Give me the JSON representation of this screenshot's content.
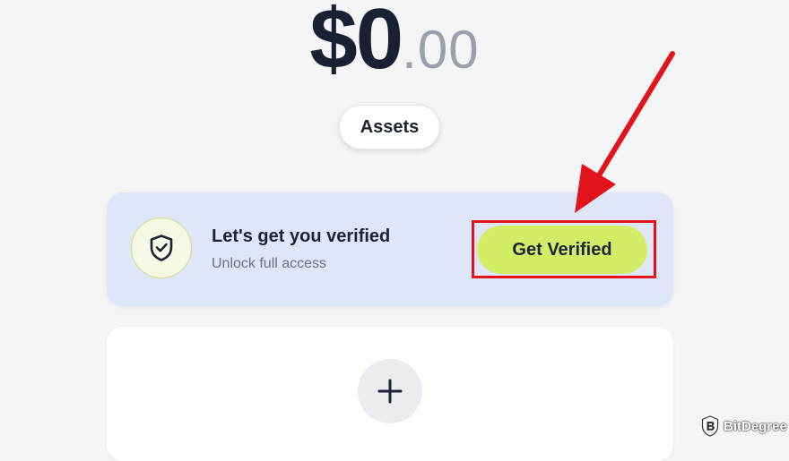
{
  "balance": {
    "main": "$0",
    "cents": ".00"
  },
  "assets": {
    "label": "Assets"
  },
  "verify_card": {
    "title": "Let's get you verified",
    "subtitle": "Unlock full access",
    "button_label": "Get Verified",
    "icon": "shield-check-icon"
  },
  "add_card": {
    "icon": "plus-icon"
  },
  "annotation": {
    "arrow_color": "#e3131c",
    "highlight_color": "#e3131c"
  },
  "watermark": {
    "text": "BitDegree",
    "icon": "bitdegree-logo-icon"
  },
  "colors": {
    "accent_button": "#d3ee66",
    "card_background": "#dee6f8",
    "page_background": "#f4f5f7"
  }
}
